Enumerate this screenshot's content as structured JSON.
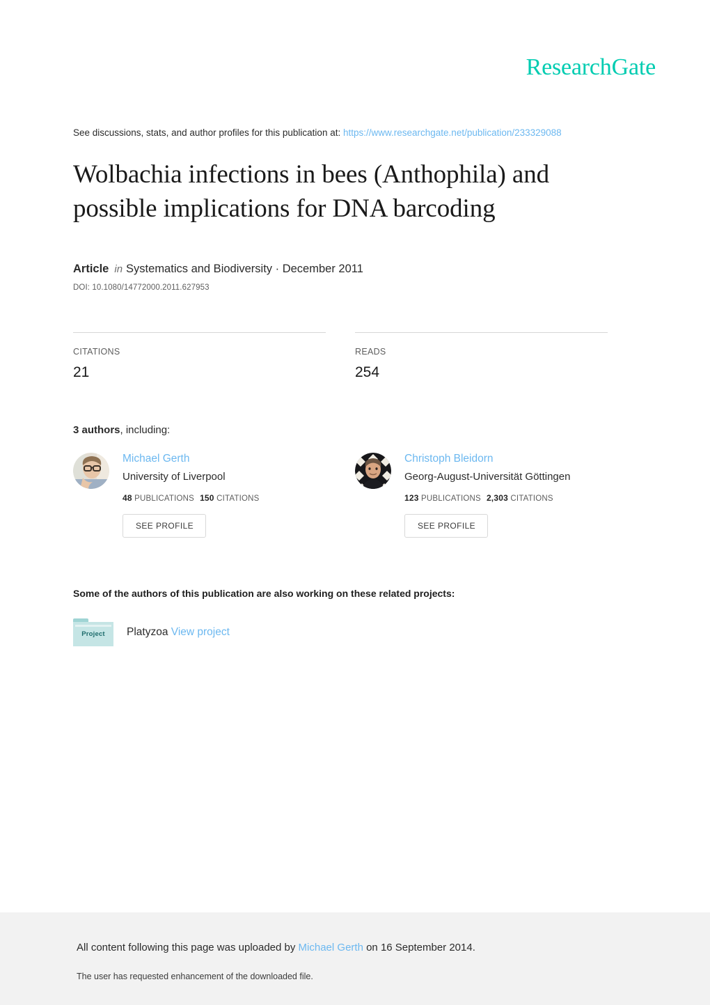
{
  "brand": {
    "logo_text": "ResearchGate",
    "accent_color": "#00ccb1",
    "link_color": "#6cb8f0"
  },
  "discussion": {
    "prefix": "See discussions, stats, and author profiles for this publication at:",
    "url": "https://www.researchgate.net/publication/233329088"
  },
  "publication": {
    "title": "Wolbachia infections in bees (Anthophila) and possible implications for DNA barcoding",
    "kind": "Article",
    "in_word": "in",
    "venue": "Systematics and Biodiversity · December 2011",
    "doi": "DOI: 10.1080/14772000.2011.627953"
  },
  "stats": [
    {
      "label": "CITATIONS",
      "value": "21"
    },
    {
      "label": "READS",
      "value": "254"
    }
  ],
  "authors_section": {
    "heading_count": "3 authors",
    "heading_rest": ", including:",
    "see_profile_label": "SEE PROFILE",
    "authors": [
      {
        "name": "Michael Gerth",
        "affiliation": "University of Liverpool",
        "publications": "48",
        "publications_label": "PUBLICATIONS",
        "citations": "150",
        "citations_label": "CITATIONS",
        "avatar": "author-photo-light"
      },
      {
        "name": "Christoph Bleidorn",
        "affiliation": "Georg-August-Universität Göttingen",
        "publications": "123",
        "publications_label": "PUBLICATIONS",
        "citations": "2,303",
        "citations_label": "CITATIONS",
        "avatar": "author-photo-dark"
      }
    ]
  },
  "projects_section": {
    "heading": "Some of the authors of this publication are also working on these related projects:",
    "projects": [
      {
        "folder_label": "Project",
        "name": "Platyzoa",
        "link_label": "View project"
      }
    ]
  },
  "footer": {
    "uploaded_prefix": "All content following this page was uploaded by ",
    "uploader": "Michael Gerth",
    "uploaded_suffix": " on 16 September 2014.",
    "enhancement_note": "The user has requested enhancement of the downloaded file."
  }
}
